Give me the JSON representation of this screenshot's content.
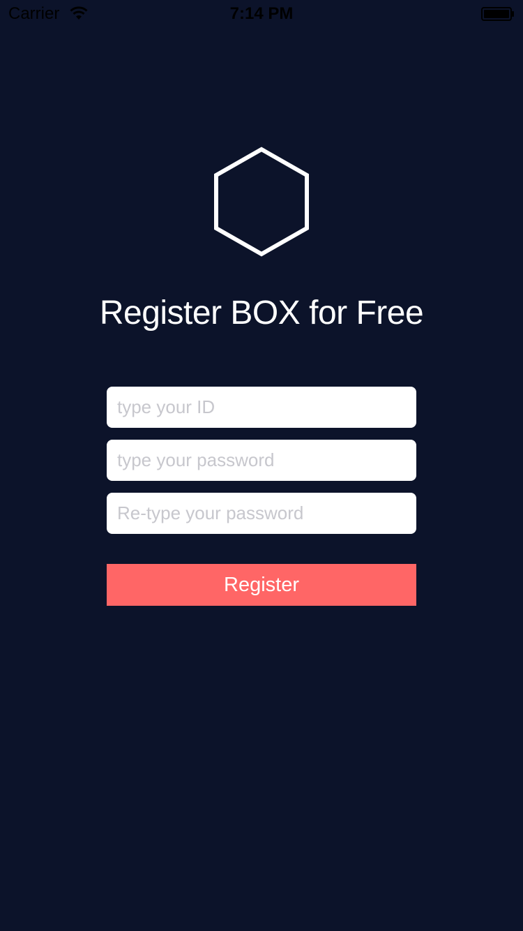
{
  "status_bar": {
    "carrier": "Carrier",
    "time": "7:14 PM",
    "wifi_icon": "wifi-icon",
    "battery_icon": "battery-icon",
    "battery_level": 1.0
  },
  "logo": {
    "icon": "hexagon-outline-icon",
    "color": "#ffffff"
  },
  "title": "Register BOX for Free",
  "form": {
    "id_field": {
      "placeholder": "type your ID",
      "value": ""
    },
    "password_field": {
      "placeholder": "type your password",
      "value": ""
    },
    "retype_field": {
      "placeholder": "Re-type your password",
      "value": ""
    }
  },
  "register_button": {
    "label": "Register",
    "color": "#ff6666"
  },
  "colors": {
    "background": "#0c132a",
    "text": "#ffffff",
    "placeholder": "#c7c7cd"
  }
}
